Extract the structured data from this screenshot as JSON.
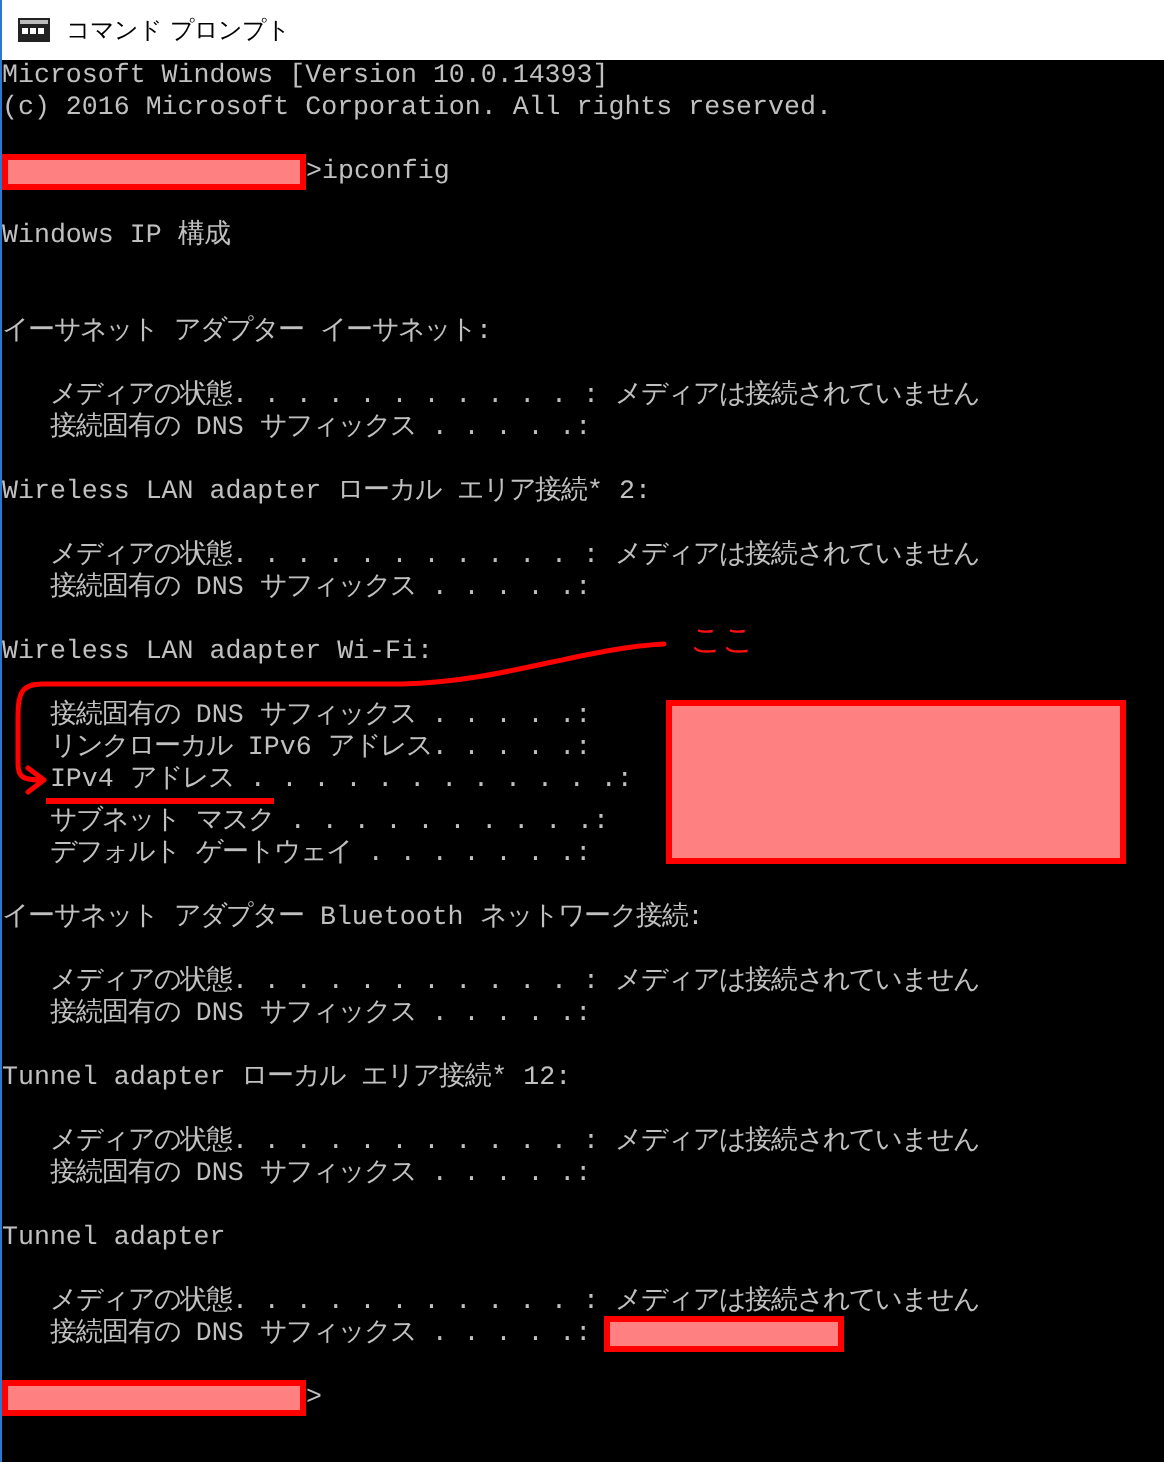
{
  "window": {
    "title": "コマンド プロンプト"
  },
  "console": {
    "lines": [
      {
        "kind": "text",
        "text": "Microsoft Windows [Version 10.0.14393]"
      },
      {
        "kind": "text",
        "text": "(c) 2016 Microsoft Corporation. All rights reserved."
      },
      {
        "kind": "blank"
      },
      {
        "kind": "prompt",
        "marker": ">",
        "command": "ipconfig"
      },
      {
        "kind": "blank"
      },
      {
        "kind": "text",
        "text": "Windows IP 構成"
      },
      {
        "kind": "blank"
      },
      {
        "kind": "blank"
      },
      {
        "kind": "text",
        "text": "イーサネット アダプター イーサネット:"
      },
      {
        "kind": "blank"
      },
      {
        "kind": "text",
        "text": "   メディアの状態. . . . . . . . . . . :",
        "value": " メディアは接続されていません"
      },
      {
        "kind": "text",
        "text": "   接続固有の DNS サフィックス . . . . .:"
      },
      {
        "kind": "blank"
      },
      {
        "kind": "text",
        "text": "Wireless LAN adapter ローカル エリア接続* 2:"
      },
      {
        "kind": "blank"
      },
      {
        "kind": "text",
        "text": "   メディアの状態. . . . . . . . . . . :",
        "value": " メディアは接続されていません"
      },
      {
        "kind": "text",
        "text": "   接続固有の DNS サフィックス . . . . .:"
      },
      {
        "kind": "blank"
      },
      {
        "kind": "text",
        "text": "Wireless LAN adapter Wi-Fi:"
      },
      {
        "kind": "blank"
      },
      {
        "kind": "text",
        "text": "   接続固有の DNS サフィックス . . . . .:"
      },
      {
        "kind": "text",
        "text": "   リンクローカル IPv6 アドレス. . . . .:"
      },
      {
        "kind": "text",
        "text": "   IPv4 アドレス . . . . . . . . . . . .:",
        "underlined": true
      },
      {
        "kind": "text",
        "text": "   サブネット マスク . . . . . . . . . .:"
      },
      {
        "kind": "text",
        "text": "   デフォルト ゲートウェイ . . . . . . .:"
      },
      {
        "kind": "blank"
      },
      {
        "kind": "text",
        "text": "イーサネット アダプター Bluetooth ネットワーク接続:"
      },
      {
        "kind": "blank"
      },
      {
        "kind": "text",
        "text": "   メディアの状態. . . . . . . . . . . :",
        "value": " メディアは接続されていません"
      },
      {
        "kind": "text",
        "text": "   接続固有の DNS サフィックス . . . . .:"
      },
      {
        "kind": "blank"
      },
      {
        "kind": "text",
        "text": "Tunnel adapter ローカル エリア接続* 12:"
      },
      {
        "kind": "blank"
      },
      {
        "kind": "text",
        "text": "   メディアの状態. . . . . . . . . . . :",
        "value": " メディアは接続されていません"
      },
      {
        "kind": "text",
        "text": "   接続固有の DNS サフィックス . . . . .:"
      },
      {
        "kind": "blank"
      },
      {
        "kind": "text",
        "text": "Tunnel adapter"
      },
      {
        "kind": "blank"
      },
      {
        "kind": "text",
        "text": "   メディアの状態. . . . . . . . . . . :",
        "value": " メディアは接続されていません"
      },
      {
        "kind": "text",
        "text": "   接続固有の DNS サフィックス . . . . .:",
        "redacted": true
      },
      {
        "kind": "blank"
      },
      {
        "kind": "prompt",
        "marker": ">"
      }
    ]
  },
  "annotation": {
    "note": "ここ"
  }
}
